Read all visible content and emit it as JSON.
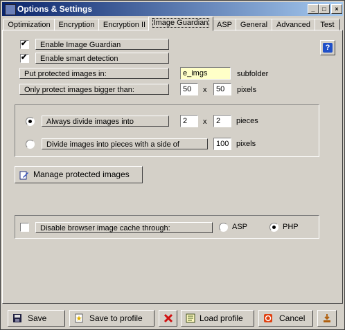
{
  "window": {
    "title": "Options & Settings"
  },
  "tabs": [
    {
      "label": "Optimization",
      "active": false
    },
    {
      "label": "Encryption",
      "active": false
    },
    {
      "label": "Encryption II",
      "active": false
    },
    {
      "label": "Image Guardian",
      "active": true
    },
    {
      "label": "ASP",
      "active": false
    },
    {
      "label": "General",
      "active": false
    },
    {
      "label": "Advanced",
      "active": false
    },
    {
      "label": "Test",
      "active": false
    }
  ],
  "guardian": {
    "enable_label": "Enable Image Guardian",
    "enable_checked": true,
    "smart_label": "Enable smart detection",
    "smart_checked": true,
    "folder_label": "Put protected images in:",
    "folder_value": "e_imgs",
    "folder_suffix": "subfolder",
    "min_size_label": "Only protect images bigger than:",
    "min_width": "50",
    "min_x": "x",
    "min_height": "50",
    "min_unit": "pixels"
  },
  "divide": {
    "always_label": "Always divide images into",
    "always_selected": true,
    "pieces_a": "2",
    "pieces_x": "x",
    "pieces_b": "2",
    "pieces_unit": "pieces",
    "side_label": "Divide images into pieces with a side of",
    "side_selected": false,
    "side_value": "100",
    "side_unit": "pixels"
  },
  "manage": {
    "label": "Manage protected images"
  },
  "cache": {
    "label": "Disable browser image cache through:",
    "checked": false,
    "asp_label": "ASP",
    "asp_selected": false,
    "php_label": "PHP",
    "php_selected": true
  },
  "footer": {
    "save": "Save",
    "save_profile": "Save to profile",
    "load_profile": "Load profile",
    "cancel": "Cancel"
  },
  "icons": {
    "save": "floppy-disk-icon",
    "save_profile": "star-document-icon",
    "delete": "red-x-icon",
    "load_profile": "load-document-icon",
    "cancel": "stop-icon",
    "extra": "download-icon",
    "help": "help-icon"
  }
}
